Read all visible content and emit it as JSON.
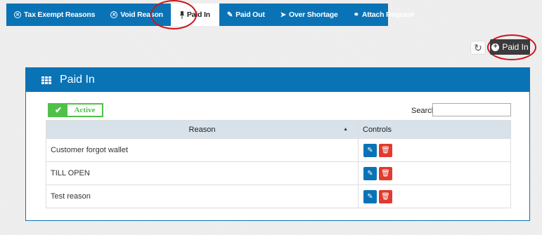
{
  "tabs": [
    {
      "label": "Tax Exempt Reasons",
      "icon": "circle-x-icon"
    },
    {
      "label": "Void Reason",
      "icon": "circle-x-icon"
    },
    {
      "label": "Paid In",
      "icon": "pin-icon",
      "active": true
    },
    {
      "label": "Paid Out",
      "icon": "pencil-icon"
    },
    {
      "label": "Over Shortage",
      "icon": "tag-icon"
    },
    {
      "label": "Attach Request",
      "icon": "link-icon"
    }
  ],
  "toolbar": {
    "add_label": "Paid In",
    "refresh_icon": "refresh-icon"
  },
  "panel": {
    "title": "Paid In",
    "icon": "table-icon"
  },
  "filter": {
    "active_label": "Active",
    "search_label": "Search",
    "search_value": ""
  },
  "table": {
    "columns": [
      "Reason",
      "Controls"
    ],
    "rows": [
      {
        "reason": "Customer forgot wallet"
      },
      {
        "reason": "TILL OPEN"
      },
      {
        "reason": "Test reason"
      }
    ]
  },
  "colors": {
    "primary": "#0a73b6",
    "active_green": "#4fc14a",
    "delete_red": "#e03b2c",
    "highlight_red": "#d0141a"
  }
}
